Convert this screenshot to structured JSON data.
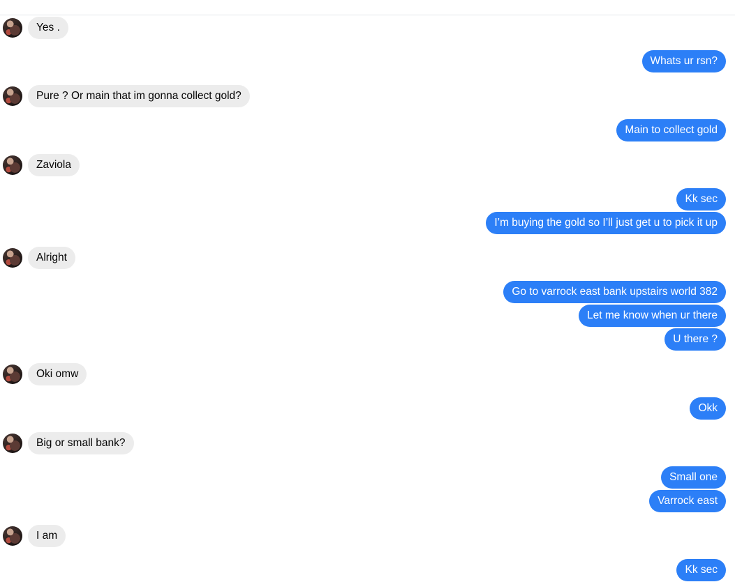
{
  "conversation": {
    "messages": [
      {
        "side": "incoming",
        "text": "Yes ."
      },
      {
        "side": "outgoing",
        "text": "Whats ur rsn?"
      },
      {
        "side": "incoming",
        "text": "Pure ? Or main that im gonna collect gold?"
      },
      {
        "side": "outgoing",
        "text": "Main to collect gold"
      },
      {
        "side": "incoming",
        "text": "Zaviola"
      },
      {
        "side": "outgoing",
        "text": "Kk sec"
      },
      {
        "side": "outgoing",
        "text": "I’m buying the gold so I’ll just get u to pick it up"
      },
      {
        "side": "incoming",
        "text": "Alright"
      },
      {
        "side": "outgoing",
        "text": "Go to varrock east bank upstairs world 382"
      },
      {
        "side": "outgoing",
        "text": "Let me know when ur there"
      },
      {
        "side": "outgoing",
        "text": "U there ?"
      },
      {
        "side": "incoming",
        "text": "Oki omw"
      },
      {
        "side": "outgoing",
        "text": "Okk"
      },
      {
        "side": "incoming",
        "text": "Big or small bank?"
      },
      {
        "side": "outgoing",
        "text": "Small one"
      },
      {
        "side": "outgoing",
        "text": "Varrock east"
      },
      {
        "side": "incoming",
        "text": "I am"
      },
      {
        "side": "outgoing",
        "text": "Kk sec"
      }
    ]
  },
  "colors": {
    "outgoing_bubble": "#2c7ff7",
    "incoming_bubble": "#ececec",
    "outgoing_text": "#ffffff",
    "incoming_text": "#050505"
  },
  "icons": {
    "contact_avatar": "avatar"
  }
}
